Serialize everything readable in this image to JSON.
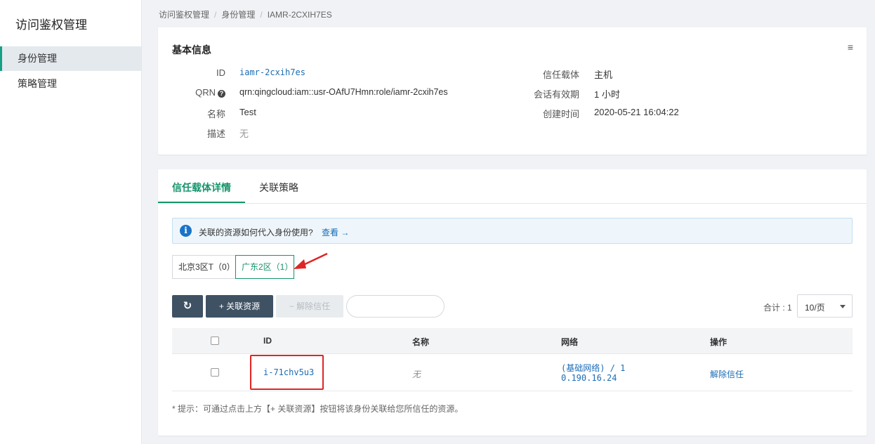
{
  "sidebar": {
    "title": "访问鉴权管理",
    "items": [
      {
        "label": "身份管理"
      },
      {
        "label": "策略管理"
      }
    ]
  },
  "breadcrumb": {
    "items": [
      "访问鉴权管理",
      "身份管理",
      "IAMR-2CXIH7ES"
    ],
    "separator": "/"
  },
  "basic_info": {
    "title": "基本信息",
    "menu_icon": "≡",
    "id_label": "ID",
    "id_value": "iamr-2cxih7es",
    "qrn_label": "QRN",
    "qrn_help": "?",
    "qrn_value": "qrn:qingcloud:iam::usr-OAfU7Hmn:role/iamr-2cxih7es",
    "name_label": "名称",
    "name_value": "Test",
    "desc_label": "描述",
    "desc_value": "无",
    "trust_label": "信任载体",
    "trust_value": "主机",
    "session_label": "会话有效期",
    "session_value": "1 小时",
    "created_label": "创建时间",
    "created_value": "2020-05-21 16:04:22"
  },
  "tabs": [
    {
      "label": "信任载体详情",
      "active": true
    },
    {
      "label": "关联策略",
      "active": false
    }
  ],
  "info": {
    "icon": "i",
    "text": "关联的资源如何代入身份使用?",
    "link": "查看 →"
  },
  "regions": [
    {
      "label": "北京3区T（0）",
      "active": false
    },
    {
      "label": "广东2区（1）",
      "active": true
    }
  ],
  "toolbar": {
    "refresh_icon": "↻",
    "add_label": "+ 关联资源",
    "remove_label": "− 解除信任",
    "search_placeholder": ""
  },
  "pagination": {
    "total": "合计 : 1",
    "page_size": "10/页"
  },
  "table": {
    "headers": [
      "ID",
      "名称",
      "网络",
      "操作"
    ],
    "rows": [
      {
        "id": "i-71chv5u3",
        "name": "无",
        "network_line1": "(基础网络) / 1",
        "network_line2": "0.190.16.24",
        "action": "解除信任"
      }
    ]
  },
  "tip": "* 提示：可通过点击上方【+ 关联资源】按钮将该身份关联给您所信任的资源。",
  "colors": {
    "accent": "#15946b",
    "link": "#1a6cb5",
    "annotation": "#e02424",
    "dark_button": "#3f5264"
  }
}
